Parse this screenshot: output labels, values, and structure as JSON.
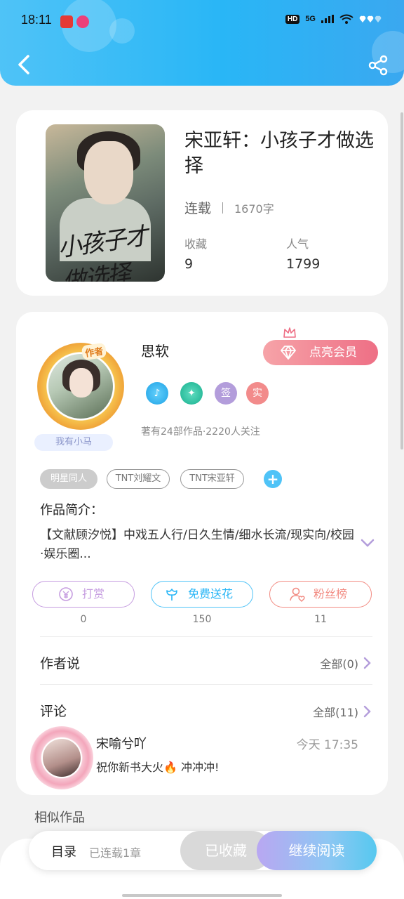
{
  "status_bar": {
    "time": "18:11",
    "indicators": [
      "HD",
      "5G"
    ]
  },
  "book": {
    "title": "宋亚轩：小孩子才做选择",
    "status": "连载",
    "word_count": "1670字",
    "stats": [
      {
        "label": "收藏",
        "value": "9"
      },
      {
        "label": "人气",
        "value": "1799"
      }
    ]
  },
  "author": {
    "tag": "作者",
    "name": "思软",
    "nickname": "我有小马",
    "vip_label": "点亮会员",
    "badges": [
      {
        "icon": "music-badge-icon",
        "text": "",
        "color": "#29b6f6"
      },
      {
        "icon": "hands-badge-icon",
        "text": "",
        "color": "#26c6a5"
      },
      {
        "icon": "signed-badge-icon",
        "text": "签",
        "color": "#b39ddb"
      },
      {
        "icon": "verified-badge-icon",
        "text": "实",
        "color": "#f28b8b"
      }
    ],
    "meta": "著有24部作品·2220人关注"
  },
  "tags": [
    "明星同人",
    "TNT刘耀文",
    "TNT宋亚轩"
  ],
  "intro": {
    "label": "作品简介：",
    "text": "【文献顾汐悦】中戏五人行/日久生情/细水长流/现实向/校园·娱乐圈..."
  },
  "actions": [
    {
      "label": "打赏",
      "count": "0",
      "color": "#c69de0"
    },
    {
      "label": "免费送花",
      "count": "150",
      "color": "#4fc3f7"
    },
    {
      "label": "粉丝榜",
      "count": "11",
      "color": "#f28b82"
    }
  ],
  "author_says": {
    "title": "作者说",
    "more": "全部(0)"
  },
  "comments": {
    "title": "评论",
    "more": "全部(11)",
    "items": [
      {
        "user": "宋喻兮吖",
        "time": "今天 17:35",
        "text": "祝你新书大火🔥 冲冲冲!"
      }
    ]
  },
  "similar": {
    "title": "相似作品"
  },
  "bottom_bar": {
    "toc": "目录",
    "toc_sub": "已连载1章",
    "favorited": "已收藏",
    "continue": "继续阅读"
  }
}
